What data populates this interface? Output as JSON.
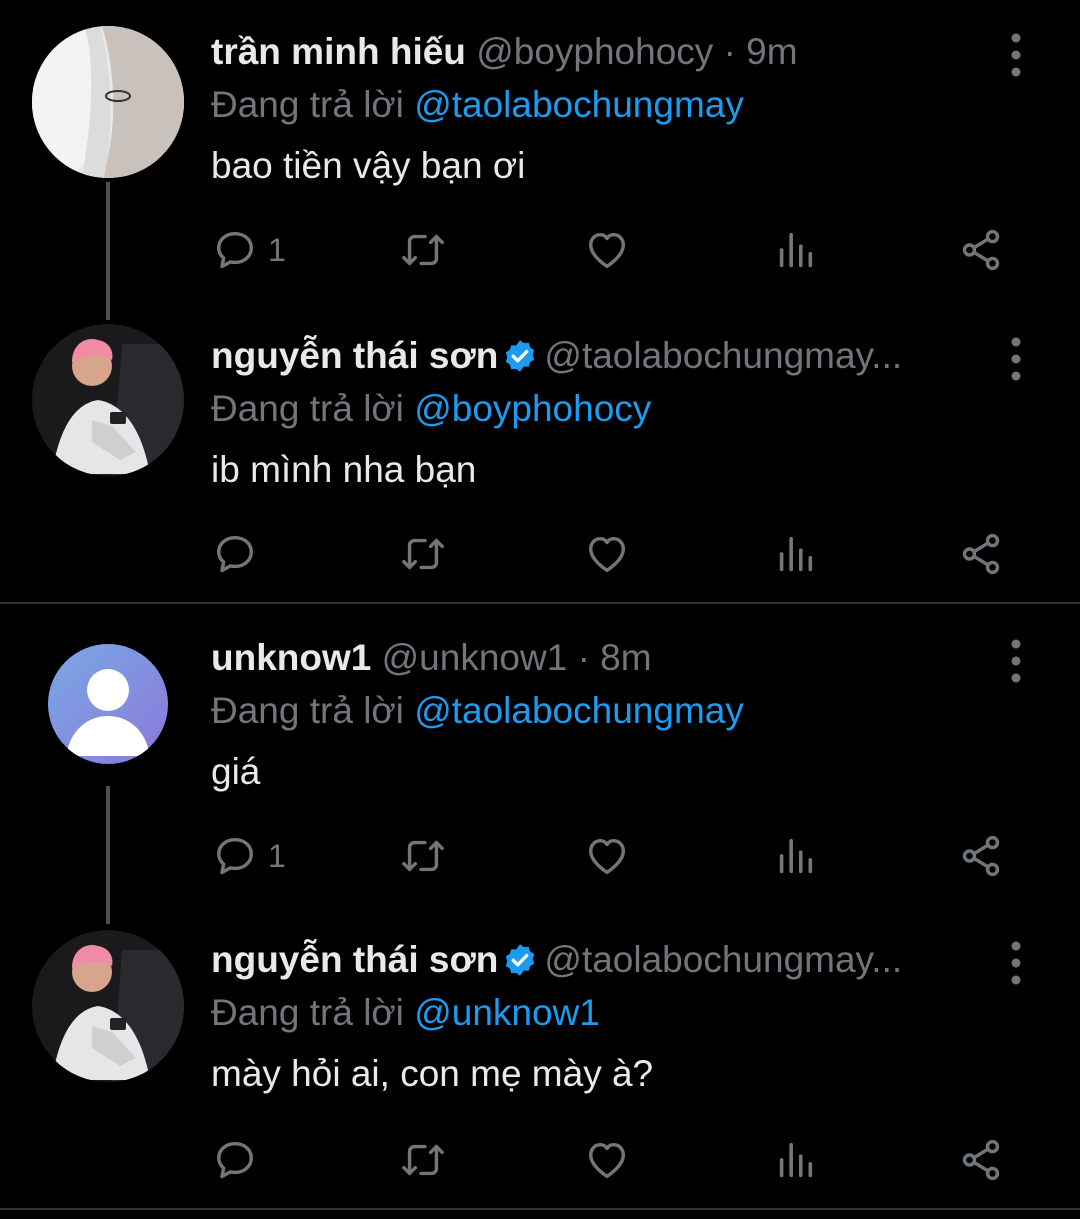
{
  "tweets": [
    {
      "name": "trần minh hiếu",
      "handle": "@boyphohocy",
      "time": "· 9m",
      "replying_label": "Đang trả lời",
      "replying_to": "@taolabochungmay",
      "text": "bao tiền vậy bạn ơi",
      "reply_count": "1",
      "verified": false
    },
    {
      "name": "nguyễn thái sơn",
      "handle": "@taolabochungmay...",
      "time": "",
      "replying_label": "Đang trả lời",
      "replying_to": "@boyphohocy",
      "text": "ib mình nha bạn",
      "reply_count": "",
      "verified": true
    },
    {
      "name": "unknow1",
      "handle": "@unknow1",
      "time": "· 8m",
      "replying_label": "Đang trả lời",
      "replying_to": "@taolabochungmay",
      "text": "giá",
      "reply_count": "1",
      "verified": false
    },
    {
      "name": "nguyễn thái sơn",
      "handle": "@taolabochungmay...",
      "time": "",
      "replying_label": "Đang trả lời",
      "replying_to": "@unknow1",
      "text": "mày hỏi ai, con mẹ mày à?",
      "reply_count": "",
      "verified": true
    }
  ],
  "icons": {
    "reply": "reply-icon",
    "retweet": "retweet-icon",
    "like": "heart-icon",
    "views": "views-icon",
    "share": "share-icon",
    "more": "more-vertical-icon",
    "verified": "verified-badge-icon"
  },
  "colors": {
    "background": "#000000",
    "text": "#e7e9ea",
    "muted": "#71767b",
    "accent": "#1d9bf0"
  }
}
